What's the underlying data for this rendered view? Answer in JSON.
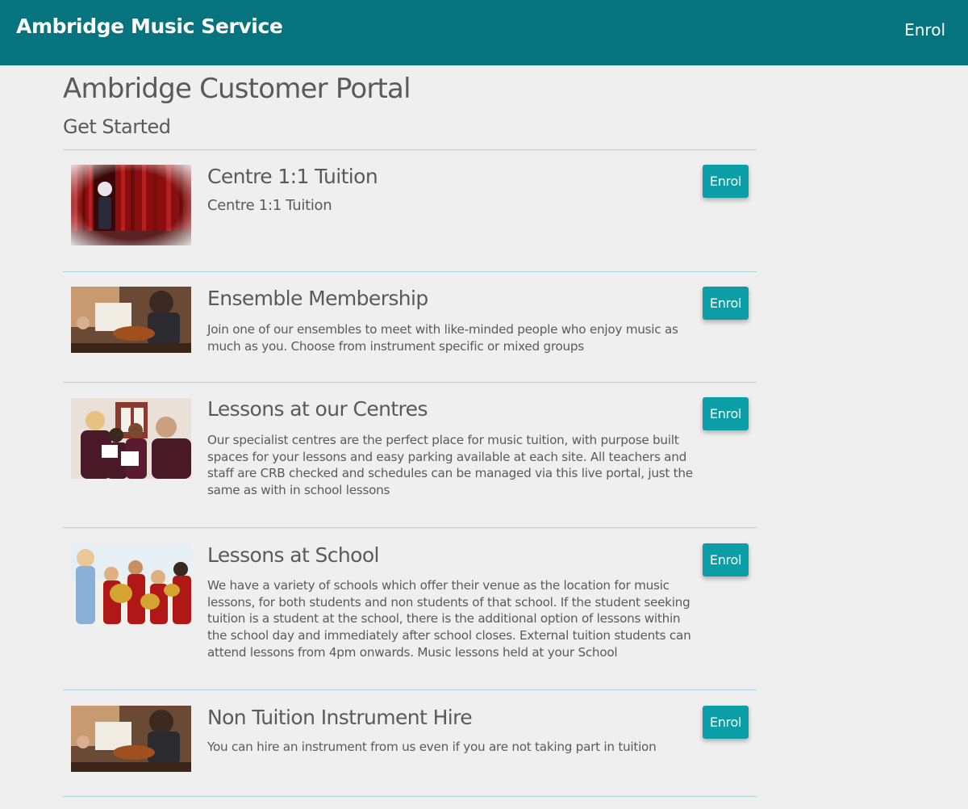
{
  "header": {
    "brand": "Ambridge Music Service",
    "nav_enrol": "Enrol"
  },
  "page": {
    "title": "Ambridge Customer Portal",
    "section_title": "Get Started"
  },
  "courses": [
    {
      "title": "Centre 1:1 Tuition",
      "description": "Centre 1:1 Tuition",
      "button": "Enrol",
      "image": "performer-on-stage-image"
    },
    {
      "title": "Ensemble Membership",
      "description": "Join one of our ensembles to meet with like-minded people who enjoy music as much as you. Choose from instrument specific or mixed groups",
      "button": "Enrol",
      "image": "orchestra-violin-image"
    },
    {
      "title": "Lessons at our Centres",
      "description": "Our specialist centres are the perfect place for music tuition, with purpose built spaces for your lessons and easy parking available at each site. All teachers and staff are CRB checked and schedules can be managed via this live portal, just the same as with in school lessons",
      "button": "Enrol",
      "image": "choir-singing-image"
    },
    {
      "title": "Lessons at School",
      "description": "We have a variety of schools which offer their venue as the location for music lessons, for both students and non students of that school. If the student seeking tuition is a student at the school, there is the additional option of lessons within the school day and immediately after school closes. External tuition students can attend lessons from 4pm onwards. Music lessons held at your School",
      "button": "Enrol",
      "image": "school-brass-band-image"
    },
    {
      "title": "Non Tuition Instrument Hire",
      "description": "You can hire an instrument from us even if you are not taking part in tuition",
      "button": "Enrol",
      "image": "orchestra-violin-image"
    }
  ],
  "colors": {
    "header_bg": "#05747f",
    "button_bg": "#0c9ea6",
    "page_bg": "#efefef",
    "divider": "#a9d6dd"
  }
}
